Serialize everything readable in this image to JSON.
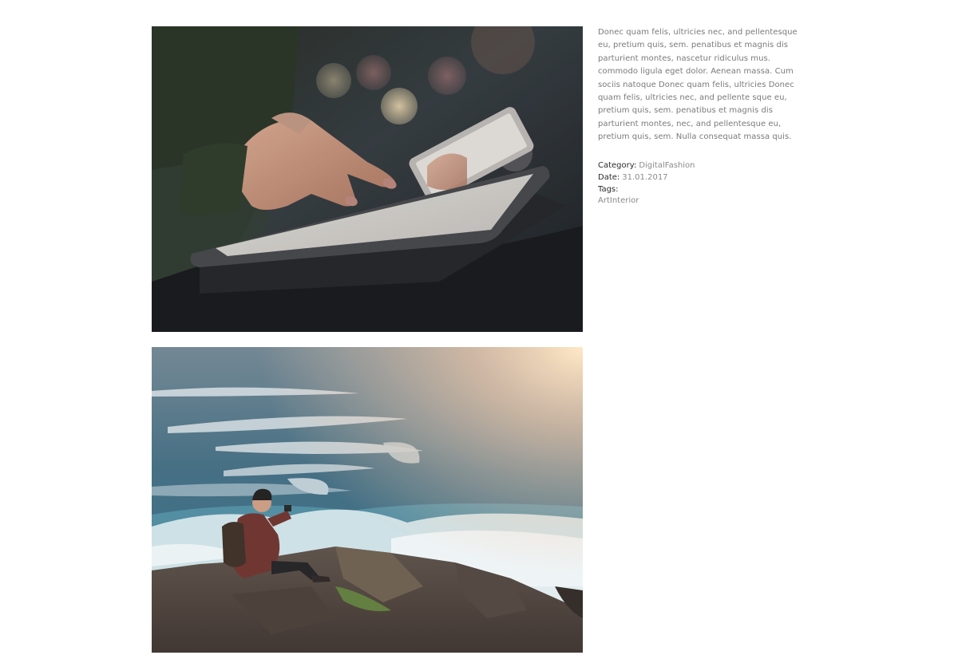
{
  "project": {
    "description": "Donec quam felis, ultricies nec, and pellentesque eu, pretium quis, sem. penatibus et magnis dis parturient montes, nascetur ridiculus mus. commodo ligula eget dolor. Aenean massa. Cum sociis natoque Donec quam felis, ultricies Donec quam felis, ultricies nec, and pellente sque eu, pretium quis, sem. penatibus et magnis dis parturient montes, nec, and pellentesque eu, pretium quis, sem. Nulla consequat massa quis.",
    "category_label": "Category:",
    "category_value": "DigitalFashion",
    "date_label": "Date:",
    "date_value": "31.01.2017",
    "tags_label": "Tags:",
    "tags_value": "ArtInterior"
  },
  "images": [
    {
      "subject": "hands-using-tablet-photo"
    },
    {
      "subject": "man-photographing-ocean-photo"
    }
  ],
  "colors": {
    "text_body": "#7a7a7a",
    "text_label": "#2b2b2b",
    "background": "#ffffff"
  }
}
